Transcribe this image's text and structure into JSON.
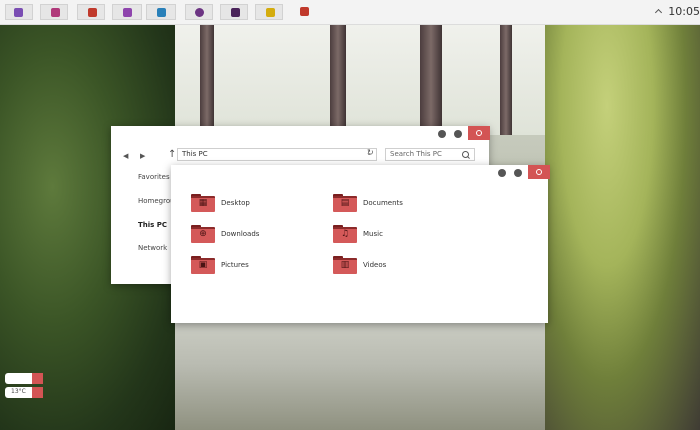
{
  "taskbar": {
    "clock": "10:05",
    "buttons": [
      {
        "name": "calendar",
        "icon": "calendar-icon",
        "color": "#7a4db3"
      },
      {
        "name": "app2",
        "icon": "app-icon",
        "color": "#b0397a"
      },
      {
        "name": "app3",
        "icon": "app-icon",
        "color": "#c0392b"
      },
      {
        "name": "app4",
        "icon": "app-icon",
        "color": "#8e44ad"
      },
      {
        "name": "app5",
        "icon": "app-icon",
        "color": "#2980b9"
      },
      {
        "name": "app6",
        "icon": "chat-icon",
        "color": "#6c3483"
      },
      {
        "name": "app7",
        "icon": "app-icon",
        "color": "#4a235a"
      },
      {
        "name": "app8",
        "icon": "app-icon",
        "color": "#d4ac0d"
      },
      {
        "name": "app9",
        "icon": "app-icon",
        "color": "#c0392b"
      }
    ]
  },
  "explorer": {
    "address": "This PC",
    "search_placeholder": "Search This PC",
    "sidebar": [
      "Favorites",
      "Homegroup",
      "This PC",
      "Network"
    ],
    "sidebar_visible": [
      "Favorites",
      "Homegrou",
      "This PC",
      "Network"
    ],
    "folders": [
      {
        "label": "Desktop",
        "icon": "desktop-icon"
      },
      {
        "label": "Documents",
        "icon": "document-icon"
      },
      {
        "label": "Downloads",
        "icon": "download-icon"
      },
      {
        "label": "Music",
        "icon": "music-icon"
      },
      {
        "label": "Pictures",
        "icon": "picture-icon"
      },
      {
        "label": "Videos",
        "icon": "video-icon"
      }
    ]
  },
  "widget": {
    "temperature": "13°C"
  },
  "colors": {
    "accent": "#d35454"
  }
}
